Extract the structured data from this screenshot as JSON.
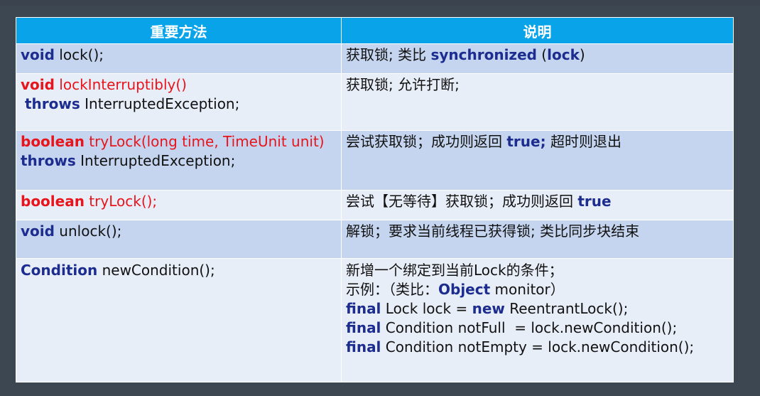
{
  "headers": {
    "method": "重要方法",
    "description": "说明"
  },
  "rows": [
    {
      "method": {
        "l1_kw": "void",
        "l1_rest": " lock();"
      },
      "desc": {
        "l1_a": "获取锁; 类比 ",
        "l1_kw1": "synchronized",
        "l1_b": " (",
        "l1_kw2": "lock",
        "l1_c": ")"
      }
    },
    {
      "method": {
        "l1_kw": "void",
        "l1_rest": " lockInterruptibly()",
        "l2_kw": "throws",
        "l2_rest": " InterruptedException;"
      },
      "desc": {
        "l1": "获取锁; 允许打断;"
      }
    },
    {
      "method": {
        "l1_kw": "boolean",
        "l1_rest": " tryLock(long time, TimeUnit unit)",
        "l2_kw": "throws",
        "l2_rest": " InterruptedException;"
      },
      "desc": {
        "l1_a": "尝试获取锁；成功则返回 ",
        "l1_kw": "true;",
        "l1_b": " 超时则退出"
      }
    },
    {
      "method": {
        "l1_kw": "boolean",
        "l1_rest": " tryLock();"
      },
      "desc": {
        "l1_a": "尝试【无等待】获取锁；成功则返回 ",
        "l1_kw": "true"
      }
    },
    {
      "method": {
        "l1_kw": "void",
        "l1_rest": " unlock();"
      },
      "desc": {
        "l1": "解锁；要求当前线程已获得锁; 类比同步块结束"
      }
    },
    {
      "method": {
        "l1_kw": "Condition",
        "l1_rest": " newCondition();"
      },
      "desc": {
        "l1": "新增一个绑定到当前Lock的条件；",
        "l2_a": "示例：（类比：",
        "l2_kw": "Object",
        "l2_b": " monitor）",
        "l3_kw1": "final",
        "l3_a": " Lock lock = ",
        "l3_kw2": "new",
        "l3_b": " ReentrantLock();",
        "l4_kw": "final",
        "l4_rest": " Condition notFull  = lock.newCondition();",
        "l5_kw": "final",
        "l5_rest": " Condition notEmpty = lock.newCondition();"
      }
    }
  ]
}
